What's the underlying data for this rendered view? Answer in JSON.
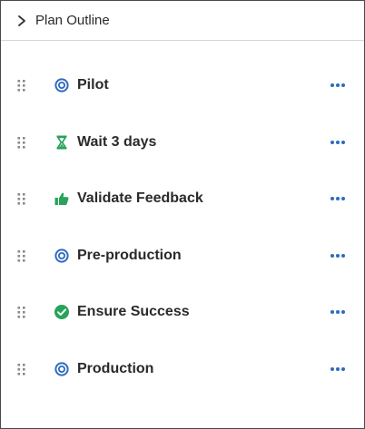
{
  "panel": {
    "title": "Plan Outline",
    "toggle_icon": "chevron-right-icon"
  },
  "items": [
    {
      "label": "Pilot",
      "icon": "target-icon",
      "icon_color": "#2d6bbf"
    },
    {
      "label": "Wait 3 days",
      "icon": "hourglass-icon",
      "icon_color": "#27a35a"
    },
    {
      "label": "Validate Feedback",
      "icon": "thumbs-up-icon",
      "icon_color": "#27a35a"
    },
    {
      "label": "Pre-production",
      "icon": "target-icon",
      "icon_color": "#2d6bbf"
    },
    {
      "label": "Ensure Success",
      "icon": "check-circle-icon",
      "icon_color": "#27a35a"
    },
    {
      "label": "Production",
      "icon": "target-icon",
      "icon_color": "#2d6bbf"
    }
  ],
  "colors": {
    "more_dots": "#2d6bbf",
    "drag_handle": "#8a8a8a",
    "border": "#4a4a4a",
    "divider": "#d6d6d6"
  }
}
